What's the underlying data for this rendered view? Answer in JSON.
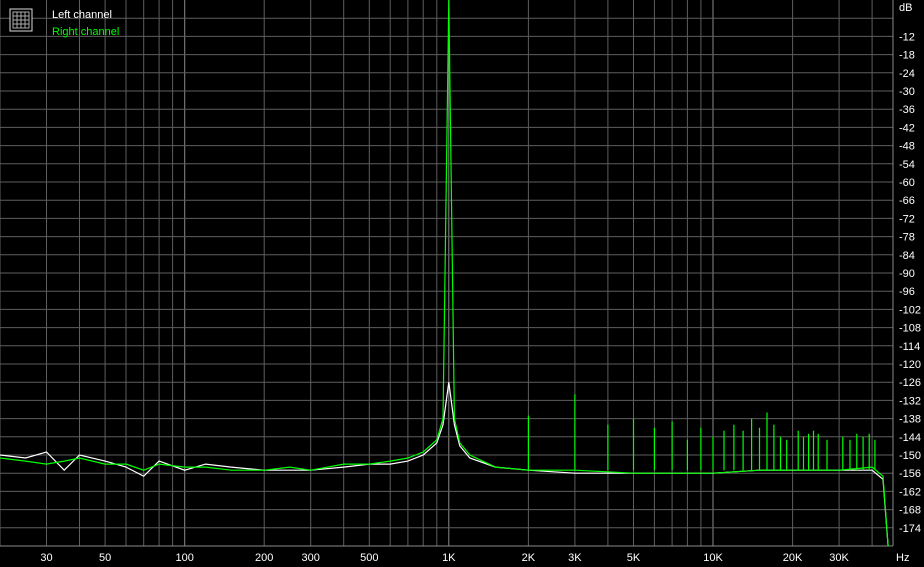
{
  "chart_data": {
    "type": "line",
    "xscale": "log",
    "xlim": [
      20,
      48000
    ],
    "ylim": [
      -180,
      0
    ],
    "grid": true,
    "x_unit_label": "Hz",
    "y_unit_label": "dB",
    "x_ticks": [
      {
        "value": 30,
        "label": "30"
      },
      {
        "value": 50,
        "label": "50"
      },
      {
        "value": 100,
        "label": "100"
      },
      {
        "value": 200,
        "label": "200"
      },
      {
        "value": 300,
        "label": "300"
      },
      {
        "value": 500,
        "label": "500"
      },
      {
        "value": 1000,
        "label": "1K"
      },
      {
        "value": 2000,
        "label": "2K"
      },
      {
        "value": 3000,
        "label": "3K"
      },
      {
        "value": 5000,
        "label": "5K"
      },
      {
        "value": 10000,
        "label": "10K"
      },
      {
        "value": 20000,
        "label": "20K"
      },
      {
        "value": 30000,
        "label": "30K"
      }
    ],
    "y_ticks": [
      -12,
      -18,
      -24,
      -30,
      -36,
      -42,
      -48,
      -54,
      -60,
      -66,
      -72,
      -78,
      -84,
      -90,
      -96,
      -102,
      -108,
      -114,
      -120,
      -126,
      -132,
      -138,
      -144,
      -150,
      -156,
      -162,
      -168,
      -174
    ],
    "legend_position": "top-left",
    "legend_icon": "spectrum-grid-icon",
    "series": [
      {
        "name": "Left channel",
        "color": "#ffffff",
        "x": [
          20,
          25,
          30,
          35,
          40,
          50,
          60,
          70,
          80,
          100,
          120,
          150,
          200,
          250,
          300,
          400,
          500,
          600,
          700,
          800,
          900,
          950,
          1000,
          1050,
          1100,
          1200,
          1500,
          2000,
          3000,
          5000,
          10000,
          15000,
          20000,
          30000,
          40000,
          44000,
          46000
        ],
        "y": [
          -150,
          -151,
          -149,
          -155,
          -150,
          -152,
          -154,
          -157,
          -152,
          -155,
          -153,
          -154,
          -155,
          -155,
          -155,
          -154,
          -153,
          -153,
          -152,
          -150,
          -146,
          -140,
          -126,
          -140,
          -147,
          -151,
          -154,
          -155,
          -156,
          -156,
          -156,
          -155,
          -155,
          -155,
          -155,
          -158,
          -180
        ]
      },
      {
        "name": "Right channel",
        "color": "#00ff00",
        "x": [
          20,
          25,
          30,
          35,
          40,
          50,
          60,
          70,
          80,
          100,
          120,
          150,
          200,
          250,
          300,
          400,
          500,
          600,
          700,
          800,
          900,
          950,
          1000,
          1050,
          1100,
          1200,
          1500,
          2000,
          3000,
          5000,
          10000,
          15000,
          20000,
          30000,
          40000,
          44000,
          46000
        ],
        "y": [
          -151,
          -152,
          -153,
          -152,
          -151,
          -153,
          -153,
          -155,
          -153,
          -154,
          -154,
          -155,
          -155,
          -154,
          -155,
          -153,
          -153,
          -152,
          -151,
          -149,
          -145,
          -138,
          0,
          -138,
          -146,
          -150,
          -154,
          -155,
          -155,
          -156,
          -156,
          -155,
          -155,
          -155,
          -154,
          -157,
          -180
        ]
      }
    ],
    "spurs": [
      {
        "freq": 2000,
        "level": -137
      },
      {
        "freq": 3000,
        "level": -130
      },
      {
        "freq": 4000,
        "level": -140
      },
      {
        "freq": 5000,
        "level": -138
      },
      {
        "freq": 6000,
        "level": -141
      },
      {
        "freq": 7000,
        "level": -139
      },
      {
        "freq": 8000,
        "level": -145
      },
      {
        "freq": 9000,
        "level": -141
      },
      {
        "freq": 10000,
        "level": -144
      },
      {
        "freq": 11000,
        "level": -142
      },
      {
        "freq": 12000,
        "level": -140
      },
      {
        "freq": 13000,
        "level": -142
      },
      {
        "freq": 14000,
        "level": -138
      },
      {
        "freq": 15000,
        "level": -141
      },
      {
        "freq": 16000,
        "level": -136
      },
      {
        "freq": 17000,
        "level": -140
      },
      {
        "freq": 18000,
        "level": -144
      },
      {
        "freq": 19000,
        "level": -145
      },
      {
        "freq": 21000,
        "level": -142
      },
      {
        "freq": 22000,
        "level": -144
      },
      {
        "freq": 23000,
        "level": -143
      },
      {
        "freq": 24000,
        "level": -142
      },
      {
        "freq": 25000,
        "level": -143
      },
      {
        "freq": 27000,
        "level": -145
      },
      {
        "freq": 31000,
        "level": -144
      },
      {
        "freq": 33000,
        "level": -145
      },
      {
        "freq": 35000,
        "level": -143
      },
      {
        "freq": 37000,
        "level": -144
      },
      {
        "freq": 39000,
        "level": -143
      },
      {
        "freq": 41000,
        "level": -145
      }
    ]
  }
}
